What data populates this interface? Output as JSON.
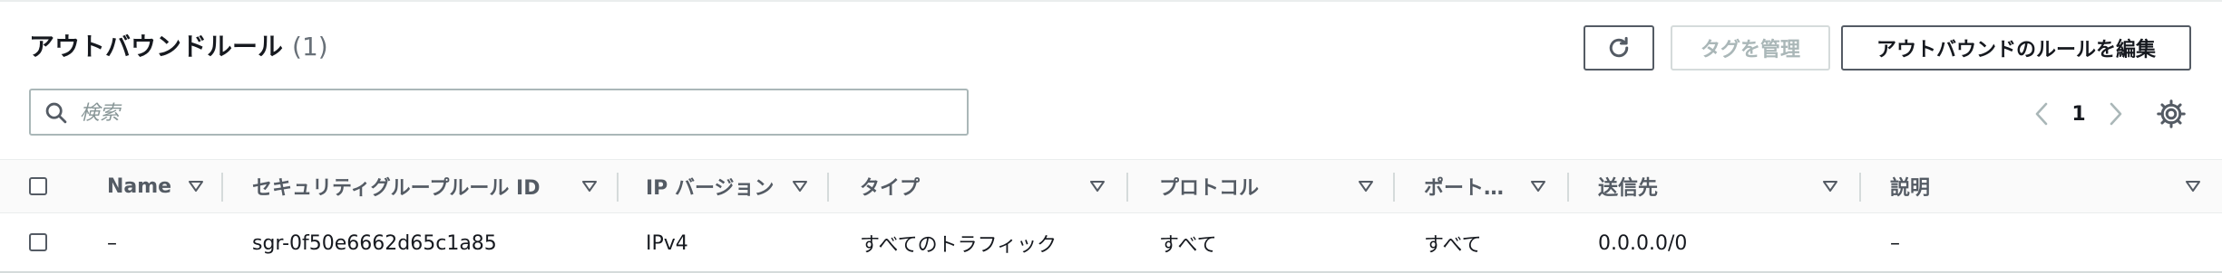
{
  "header": {
    "title": "アウトバウンドルール",
    "count": "(1)"
  },
  "toolbar": {
    "refresh_icon": "refresh-icon",
    "manage_tags_label": "タグを管理",
    "edit_rules_label": "アウトバウンドのルールを編集"
  },
  "search": {
    "placeholder": "検索",
    "value": ""
  },
  "pagination": {
    "current_page": "1"
  },
  "table": {
    "columns": [
      {
        "label": "Name"
      },
      {
        "label": "セキュリティグループルール ID"
      },
      {
        "label": "IP バージョン"
      },
      {
        "label": "タイプ"
      },
      {
        "label": "プロトコル"
      },
      {
        "label": "ポート…"
      },
      {
        "label": "送信先"
      },
      {
        "label": "説明"
      }
    ],
    "rows": [
      {
        "name": "–",
        "rule_id": "sgr-0f50e6662d65c1a85",
        "ip_version": "IPv4",
        "type": "すべてのトラフィック",
        "protocol": "すべて",
        "port_range": "すべて",
        "destination": "0.0.0.0/0",
        "description": "–"
      }
    ]
  },
  "colors": {
    "border": "#aab7b8",
    "text": "#16191f",
    "muted": "#545b64",
    "disabled": "#aab7b8",
    "header_bg": "#fafafa"
  }
}
